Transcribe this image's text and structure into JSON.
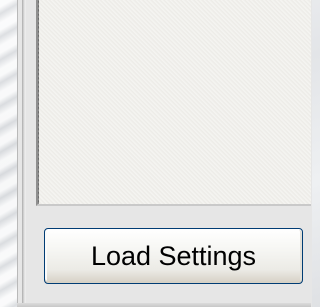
{
  "panel": {
    "background_color": "#e6e6e6",
    "listbox_color": "#f1f0ec"
  },
  "load_settings_button": {
    "label": "Load Settings",
    "border_color": "#003c74"
  }
}
